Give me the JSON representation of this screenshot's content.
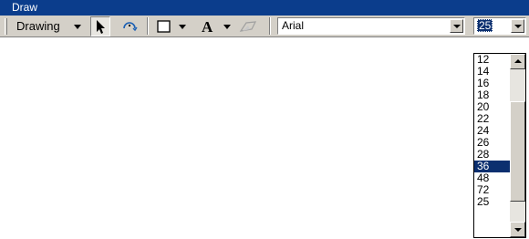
{
  "window": {
    "title": "Draw"
  },
  "toolbar": {
    "drawing_menu_label": "Drawing",
    "font_name": "Arial",
    "font_size": "25",
    "icons": [
      "select-pointer-icon",
      "rotate-icon",
      "rectangle-icon",
      "text-icon",
      "edit-vertices-icon"
    ]
  },
  "font_size_dropdown": {
    "options": [
      "12",
      "14",
      "16",
      "18",
      "20",
      "22",
      "24",
      "26",
      "28",
      "36",
      "48",
      "72",
      "25"
    ],
    "highlighted": "36"
  },
  "colors": {
    "title_bar": "#0b3d8c",
    "selection": "#0b2f6f",
    "face": "#d4d0c8"
  }
}
